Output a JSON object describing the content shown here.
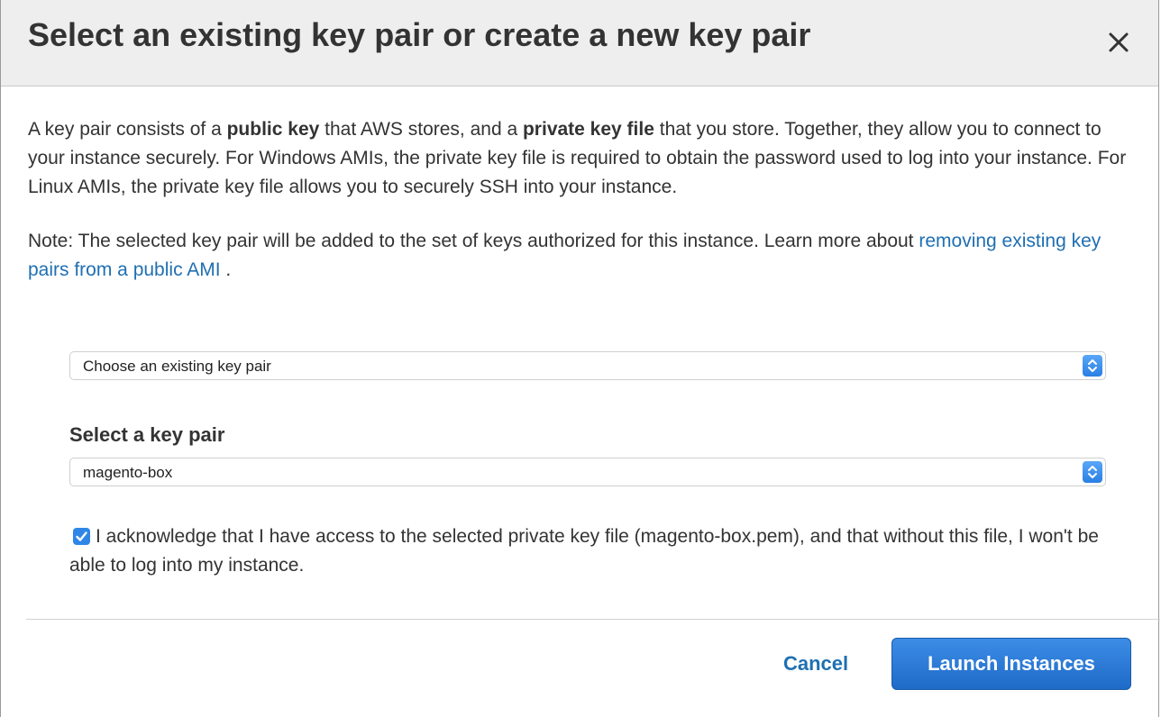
{
  "dialog": {
    "title": "Select an existing key pair or create a new key pair",
    "close_icon": "close-icon"
  },
  "intro": {
    "part1": "A key pair consists of a ",
    "bold1": "public key",
    "part2": " that AWS stores, and a ",
    "bold2": "private key file",
    "part3": " that you store. Together, they allow you to connect to your instance securely. For Windows AMIs, the private key file is required to obtain the password used to log into your instance. For Linux AMIs, the private key file allows you to securely SSH into your instance."
  },
  "note": {
    "text": "Note: The selected key pair will be added to the set of keys authorized for this instance. Learn more about ",
    "link": "removing existing key pairs from a public AMI",
    "suffix": " ."
  },
  "key_option_select": {
    "value": "Choose an existing key pair",
    "icon": "stepper-icon"
  },
  "key_pair": {
    "label": "Select a key pair",
    "value": "magento-box",
    "icon": "stepper-icon"
  },
  "acknowledge": {
    "checked": true,
    "text": "I acknowledge that I have access to the selected private key file (magento-box.pem), and that without this file, I won't be able to log into my instance.",
    "icon": "checkmark-icon"
  },
  "footer": {
    "cancel_label": "Cancel",
    "launch_label": "Launch Instances"
  },
  "colors": {
    "link": "#1f6fb2",
    "primary_button": "#2a78d6",
    "checkbox": "#2f86e6",
    "header_bg": "#eeeeee"
  }
}
